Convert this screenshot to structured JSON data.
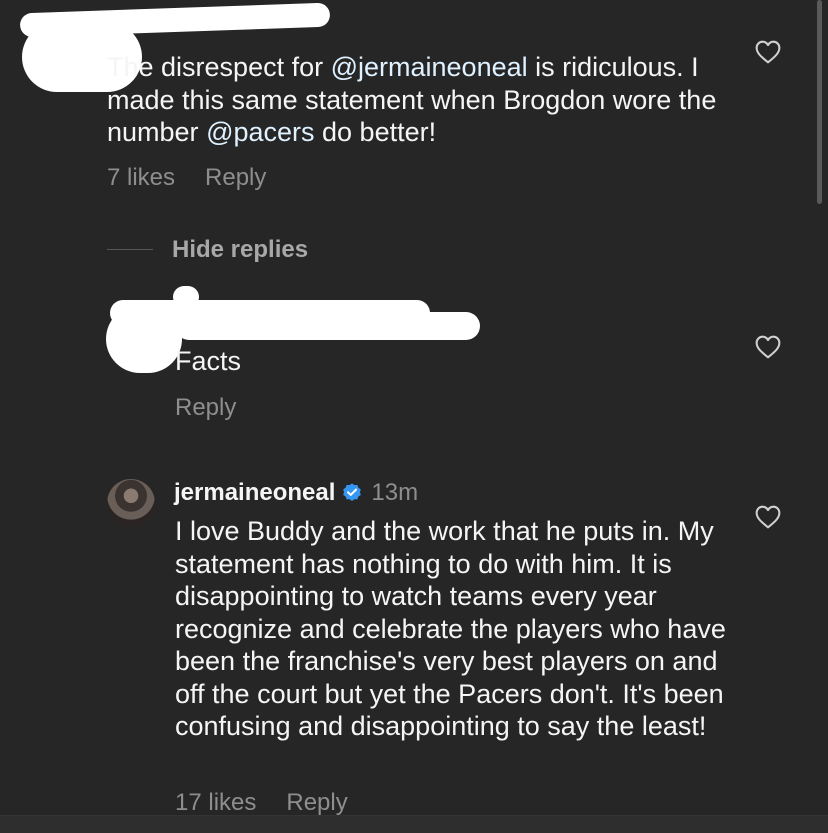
{
  "comment1": {
    "text_parts": [
      "The disrespect for ",
      "@jermaineoneal",
      " is ridiculous. I made this same statement when Brogdon wore the number ",
      "@pacers",
      " do better!"
    ],
    "likes": "7 likes",
    "reply": "Reply"
  },
  "thread": {
    "hide_replies": "Hide replies"
  },
  "reply1": {
    "text": "Facts",
    "reply": "Reply"
  },
  "reply2": {
    "username": "jermaineoneal",
    "verified_icon": "verified-badge-icon",
    "time": "13m",
    "text": "I love Buddy and the work that he puts in. My statement has nothing to do with him. It is disappointing to watch teams every year recognize and celebrate the players who have been the franchise's very best players on and off the court but yet the Pacers don't. It's been confusing and disappointing to say the least!",
    "likes": "17 likes",
    "reply": "Reply"
  },
  "icons": {
    "like": "heart-outline-icon",
    "avatar": "profile-avatar"
  },
  "colors": {
    "background": "#262626",
    "text": "#f5f5f5",
    "secondary": "#8e8e8e",
    "mention": "#e0f1ff",
    "verified": "#3797f0"
  }
}
